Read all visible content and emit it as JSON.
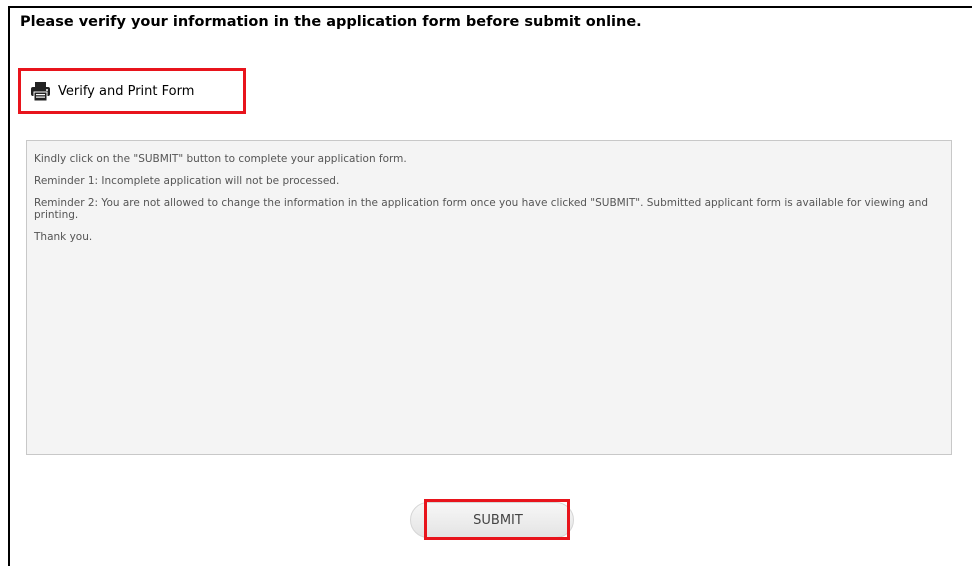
{
  "page": {
    "heading": "Please verify your information in the application form before submit online."
  },
  "print_link": {
    "label": "Verify and Print Form",
    "icon": "printer-icon"
  },
  "notice": {
    "paragraphs": [
      "Kindly click on the \"SUBMIT\" button to complete your application form.",
      "Reminder 1: Incomplete application will not be processed.",
      "Reminder 2: You are not allowed to change the information in the application form once you have clicked \"SUBMIT\". Submitted applicant form is available for viewing and printing.",
      "Thank you."
    ]
  },
  "submit": {
    "label": "SUBMIT"
  },
  "colors": {
    "highlight": "#e8141c",
    "notice_background": "#f4f4f4",
    "notice_text": "#555555"
  }
}
